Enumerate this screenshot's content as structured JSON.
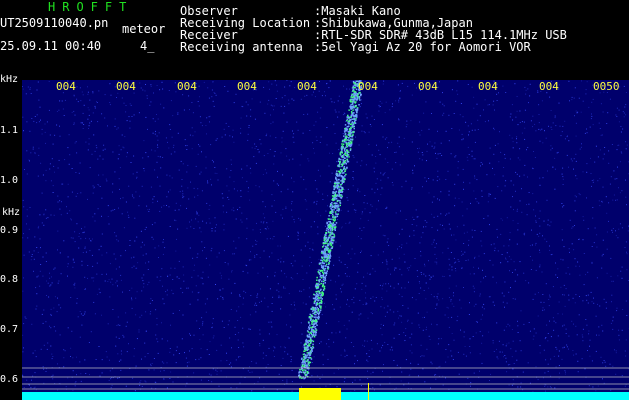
{
  "app": {
    "title": "HROFFT"
  },
  "file": {
    "name": "UT2509110040.pn",
    "tag": "meteor",
    "datetime": "25.09.11 00:40",
    "count": "4_"
  },
  "meta": {
    "labels": [
      "Observer",
      "Receiving Location",
      "Receiver",
      "Receiving antenna"
    ],
    "values": [
      ":Masaki Kano",
      ":Shibukawa,Gunma,Japan",
      ":RTL-SDR SDR# 43dB L15 114.1MHz USB",
      ":5el Yagi Az 20 for Aomori VOR"
    ]
  },
  "chart_data": {
    "type": "heatmap",
    "title": "",
    "ylabel": "kHz",
    "yticks": [
      "1.1",
      "1.0",
      "0.9",
      "0.8",
      "0.7",
      "0.6"
    ],
    "xticks": [
      "004",
      "004",
      "004",
      "004",
      "004",
      "004",
      "004",
      "004",
      "004",
      "0050"
    ],
    "ylim": [
      0.58,
      1.19
    ],
    "colors": {
      "background": "#00006c",
      "noise": "#3a4dff",
      "signal": "#40ff80",
      "baseline": "#00ffff",
      "burst": "#ffff00",
      "ticks": "#ffff40"
    }
  }
}
